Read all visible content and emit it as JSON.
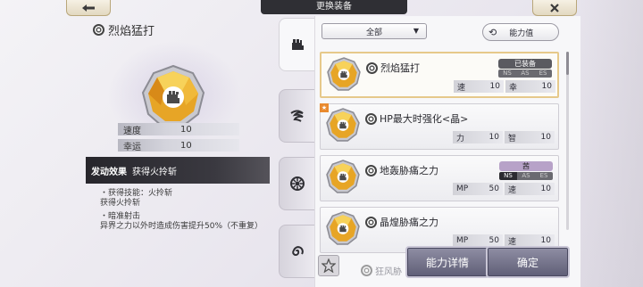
{
  "header": {
    "title": "更换装备",
    "back_icon": "arrow-left-icon",
    "close_icon": "close-icon"
  },
  "detail": {
    "name": "烈焰猛打",
    "stats": [
      {
        "label": "速度",
        "value": "10"
      },
      {
        "label": "幸运",
        "value": "10"
      }
    ],
    "effect_heading": "发动效果",
    "effect_summary": "获得火拎斩",
    "effect_lines_1": [
      "・获得技能：火拎斩",
      "获得火拎斩"
    ],
    "effect_lines_2": [
      "・暗准射击",
      "异界之力以外时造成伤害提升50%（不重复）"
    ]
  },
  "side_tabs": [
    "fist-icon",
    "wind-swirl-icon",
    "gear-cog-icon",
    "spiral-icon"
  ],
  "filter": {
    "selected": "全部",
    "sort_label": "能力值"
  },
  "list": [
    {
      "name": "烈焰猛打",
      "badge": "已装备",
      "ranks": [
        "NS",
        "AS",
        "ES"
      ],
      "ranks_on": [],
      "stats": [
        {
          "k": "速",
          "v": "10"
        },
        {
          "k": "幸",
          "v": "10"
        }
      ],
      "selected": true,
      "new": false
    },
    {
      "name": "HP最大时强化<晶>",
      "badge": "",
      "ranks": [],
      "ranks_on": [],
      "stats": [
        {
          "k": "力",
          "v": "10"
        },
        {
          "k": "智",
          "v": "10"
        }
      ],
      "selected": false,
      "new": true
    },
    {
      "name": "地轰胁痛之力",
      "badge": "茜",
      "ranks": [
        "NS",
        "AS",
        "ES"
      ],
      "ranks_on": [
        "NS"
      ],
      "stats": [
        {
          "k": "MP",
          "v": "50"
        },
        {
          "k": "速",
          "v": "10"
        }
      ],
      "selected": false,
      "new": false
    },
    {
      "name": "晶煌胁痛之力",
      "badge": "",
      "ranks": [],
      "ranks_on": [],
      "stats": [
        {
          "k": "MP",
          "v": "50"
        },
        {
          "k": "速",
          "v": "10"
        }
      ],
      "selected": false,
      "new": false
    }
  ],
  "partial_item": "狂风胁",
  "buttons": {
    "detail": "能力详情",
    "confirm": "确定"
  },
  "colors": {
    "accent_gold": "#e6b23a",
    "dark_bar": "#2f2f34",
    "button": "#6e6d86"
  }
}
